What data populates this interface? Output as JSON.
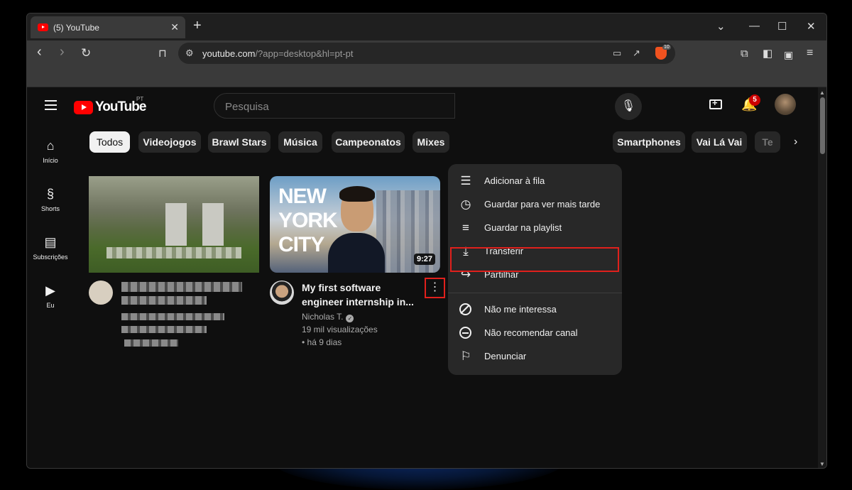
{
  "browser": {
    "tab_title": "(5) YouTube",
    "tab_close": "✕",
    "new_tab": "+",
    "url_host": "youtube.com",
    "url_rest": "/?app=desktop&hl=pt-pt",
    "brave_badge": "10",
    "window_controls": {
      "chevron": "⌄",
      "minimize": "—",
      "maximize": "☐",
      "close": "✕"
    }
  },
  "youtube": {
    "logo_text": "YouTube",
    "country_code": "PT",
    "search_placeholder": "Pesquisa",
    "notifications_count": "5"
  },
  "sidebar": {
    "items": [
      {
        "label": "Início",
        "icon": "home-icon"
      },
      {
        "label": "Shorts",
        "icon": "shorts-icon"
      },
      {
        "label": "Subscrições",
        "icon": "subscriptions-icon"
      },
      {
        "label": "Eu",
        "icon": "you-icon"
      }
    ]
  },
  "chips": [
    "Todos",
    "Videojogos",
    "Brawl Stars",
    "Música",
    "Campeonatos",
    "Mixes",
    "Smartphones",
    "Vai Lá Vai",
    "Te"
  ],
  "video": {
    "thumbnail_text_line1": "NEW",
    "thumbnail_text_line2": "YORK",
    "thumbnail_text_line3": "CITY",
    "duration": "9:27",
    "title_line1": "My first software",
    "title_line2": "engineer internship in...",
    "channel": "Nicholas T.",
    "views": "19 mil visualizações",
    "age": "• há 9 dias"
  },
  "menu": {
    "items": [
      {
        "label": "Adicionar à fila",
        "icon": "add-to-queue-icon"
      },
      {
        "label": "Guardar para ver mais tarde",
        "icon": "clock-icon"
      },
      {
        "label": "Guardar na playlist",
        "icon": "playlist-add-icon"
      },
      {
        "label": "Transferir",
        "icon": "download-icon"
      },
      {
        "label": "Partilhar",
        "icon": "share-icon"
      },
      {
        "label": "Não me interessa",
        "icon": "not-interested-icon"
      },
      {
        "label": "Não recomendar canal",
        "icon": "dont-recommend-icon"
      },
      {
        "label": "Denunciar",
        "icon": "flag-icon"
      }
    ]
  },
  "colors": {
    "highlight": "#e0201c",
    "youtube_red": "#ff0000",
    "background": "#0f0f0f",
    "menu_bg": "#282828"
  }
}
